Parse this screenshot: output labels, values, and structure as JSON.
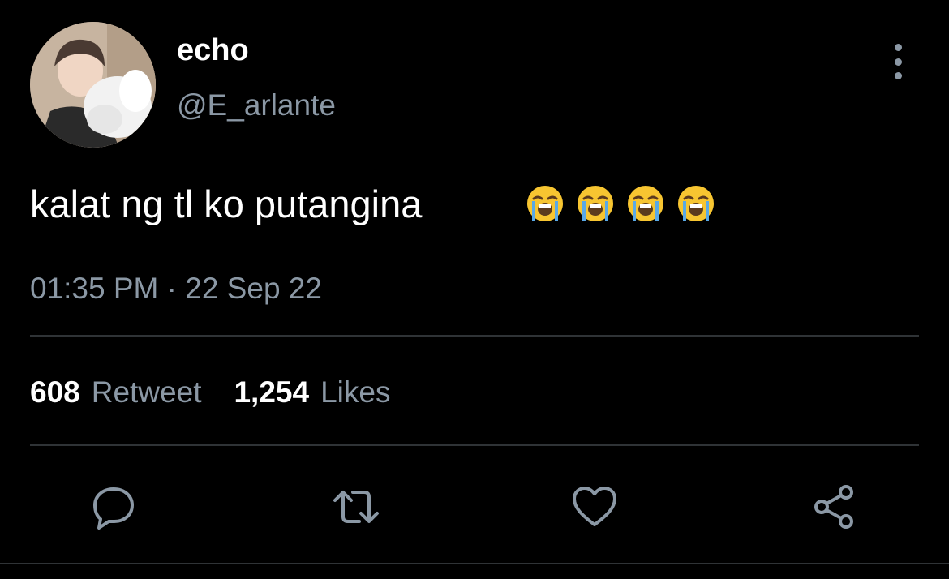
{
  "user": {
    "display_name": "echo",
    "handle": "@E_arlante",
    "avatar_icon": "profile-photo"
  },
  "tweet": {
    "text": "kalat ng tl ko putangina",
    "emojis": [
      "loudly-crying-face",
      "loudly-crying-face",
      "loudly-crying-face",
      "loudly-crying-face"
    ],
    "timestamp": "01:35 PM · 22 Sep 22"
  },
  "stats": {
    "retweets_count": "608",
    "retweets_label": "Retweet",
    "likes_count": "1,254",
    "likes_label": "Likes"
  },
  "actions": {
    "reply_icon": "comment-icon",
    "retweet_icon": "retweet-icon",
    "like_icon": "heart-icon",
    "share_icon": "share-icon"
  },
  "colors": {
    "background": "#000000",
    "primary_text": "#ffffff",
    "secondary_text": "#8b98a5",
    "divider": "#2f3336",
    "emoji_face": "#f7c531",
    "emoji_tears": "#5aa9e6"
  }
}
